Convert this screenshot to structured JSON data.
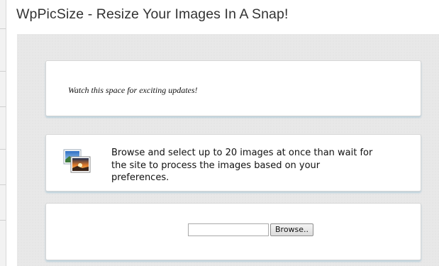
{
  "header": {
    "title": "WpPicSize - Resize Your Images In A Snap!"
  },
  "notice_card": {
    "text": "Watch this space for exciting updates!"
  },
  "info_card": {
    "icon": "images-icon",
    "text": "Browse and select up to 20 images at once than wait for the site to process the images based on your preferences."
  },
  "upload_card": {
    "file_value": "",
    "browse_label": "Browse.."
  }
}
